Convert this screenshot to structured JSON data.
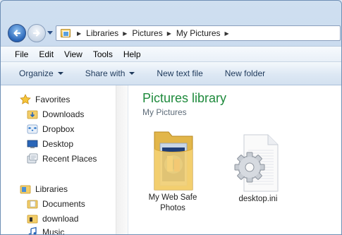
{
  "window": {
    "breadcrumbs": [
      "Libraries",
      "Pictures",
      "My Pictures"
    ]
  },
  "menubar": {
    "items": [
      "File",
      "Edit",
      "View",
      "Tools",
      "Help"
    ]
  },
  "toolbar": {
    "organize": "Organize",
    "share_with": "Share with",
    "new_text_file": "New text file",
    "new_folder": "New folder"
  },
  "navigation": {
    "favorites_header": "Favorites",
    "favorites": [
      "Downloads",
      "Dropbox",
      "Desktop",
      "Recent Places"
    ],
    "libraries_header": "Libraries",
    "libraries": [
      "Documents",
      "download",
      "Music"
    ]
  },
  "library": {
    "title": "Pictures library",
    "subtitle": "My Pictures"
  },
  "files": [
    {
      "name_line1": "My Web Safe",
      "name_line2": "Photos",
      "type": "folder-icon"
    },
    {
      "name_line1": "desktop.ini",
      "type": "settings-file-icon"
    }
  ],
  "colors": {
    "library_title": "#1e8a3c",
    "accent": "#2a66b8"
  }
}
